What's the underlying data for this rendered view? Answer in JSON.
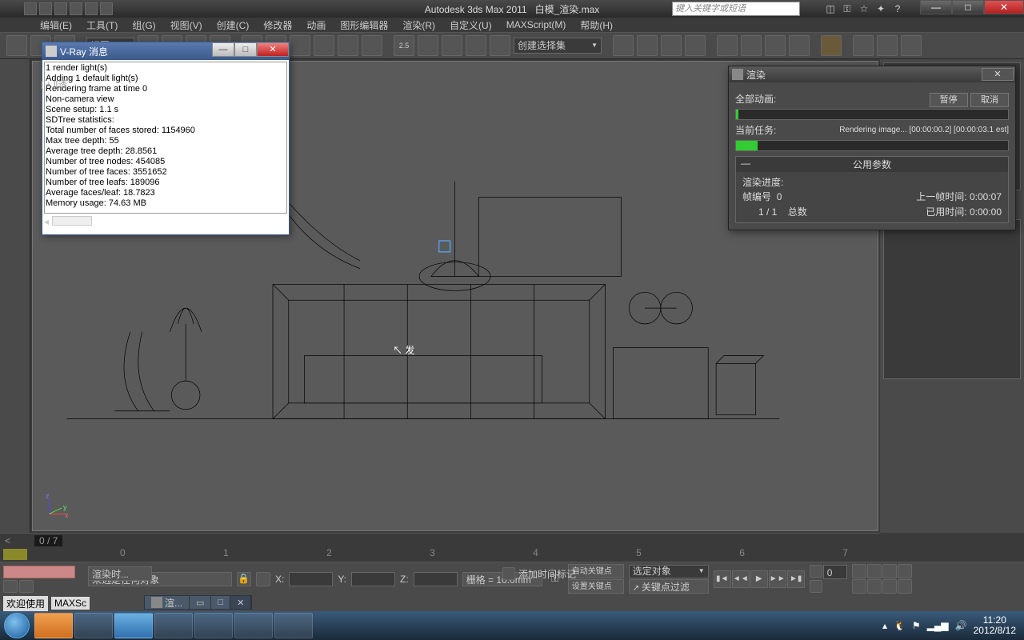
{
  "titlebar": {
    "app": "Autodesk 3ds Max  2011",
    "file": "白模_渲染.max",
    "search_placeholder": "键入关键字或短语"
  },
  "menus": [
    "编辑(E)",
    "工具(T)",
    "组(G)",
    "视图(V)",
    "创建(C)",
    "修改器",
    "动画",
    "图形编辑器",
    "渲染(R)",
    "自定义(U)",
    "MAXScript(M)",
    "帮助(H)"
  ],
  "toolbar": {
    "view_combo": "视图",
    "selset_combo": "创建选择集"
  },
  "viewport": {
    "label": "[ + ][透",
    "cursor_label": "发"
  },
  "timeline": {
    "frame": "0 / 7",
    "ticks": [
      "0",
      "1",
      "2",
      "3",
      "4",
      "5",
      "6",
      "7"
    ]
  },
  "status": {
    "selection": "未选定任何对象",
    "x": "X:",
    "y": "Y:",
    "z": "Z:",
    "grid": "栅格 = 10.0mm",
    "autokey": "自动关键点",
    "selobj": "选定对象",
    "setkey": "设置关键点",
    "keyfilter": "关键点过滤器...",
    "addtag": "添加时间标记",
    "rendtime": "渲染时..."
  },
  "welcome": {
    "use": "欢迎使用",
    "maxsc": "MAXSc"
  },
  "vray": {
    "title": "V-Ray 消息",
    "log": "1 render light(s)\nAdding 1 default light(s)\nRendering frame at time 0\nNon-camera view\nScene setup: 1.1 s\nSDTree statistics:\nTotal number of faces stored: 1154960\nMax tree depth: 55\nAverage tree depth: 28.8561\nNumber of tree nodes: 454085\nNumber of tree faces: 3551652\nNumber of tree leafs: 189096\nAverage faces/leaf: 18.7823\nMemory usage: 74.63 MB"
  },
  "render": {
    "title": "渲染",
    "allanim": "全部动画:",
    "pause": "暂停",
    "cancel": "取消",
    "curtask": "当前任务:",
    "taskmsg": "Rendering image... [00:00:00.2] [00:00:03.1 est]",
    "progress_pct": 8,
    "params_title": "公用参数",
    "renderprog": "渲染进度:",
    "frameno_l": "帧编号",
    "frameno_v": "0",
    "lastframe_l": "上一帧时间:",
    "lastframe_v": "0:00:07",
    "total_l": "1 / 1",
    "total_word": "总数",
    "used_l": "已用时间:",
    "used_v": "0:00:00"
  },
  "minitask": {
    "item": "渲..."
  },
  "tray": {
    "time": "11:20",
    "date": "2012/8/12"
  }
}
